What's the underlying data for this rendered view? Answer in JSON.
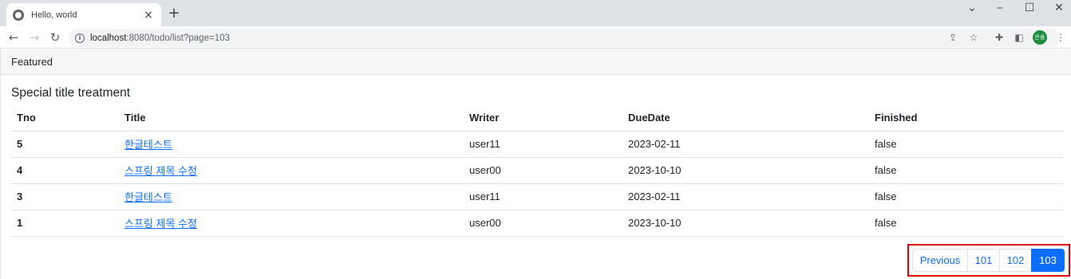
{
  "browser": {
    "tab_title": "Hello, world",
    "tab_close": "×",
    "new_tab": "+",
    "url_host": "localhost",
    "url_rest": ":8080/todo/list?page=103",
    "avatar_text": "은용"
  },
  "card": {
    "header": "Featured",
    "title": "Special title treatment"
  },
  "table": {
    "headers": [
      "Tno",
      "Title",
      "Writer",
      "DueDate",
      "Finished"
    ],
    "rows": [
      {
        "tno": "5",
        "title": "한글테스트",
        "writer": "user11",
        "due": "2023-02-11",
        "finished": "false"
      },
      {
        "tno": "4",
        "title": "스프링 제목 수정",
        "writer": "user00",
        "due": "2023-10-10",
        "finished": "false"
      },
      {
        "tno": "3",
        "title": "한글테스트",
        "writer": "user11",
        "due": "2023-02-11",
        "finished": "false"
      },
      {
        "tno": "1",
        "title": "스프링 제목 수정",
        "writer": "user00",
        "due": "2023-10-10",
        "finished": "false"
      }
    ]
  },
  "pagination": {
    "previous": "Previous",
    "pages": [
      "101",
      "102",
      "103"
    ],
    "active": "103"
  }
}
